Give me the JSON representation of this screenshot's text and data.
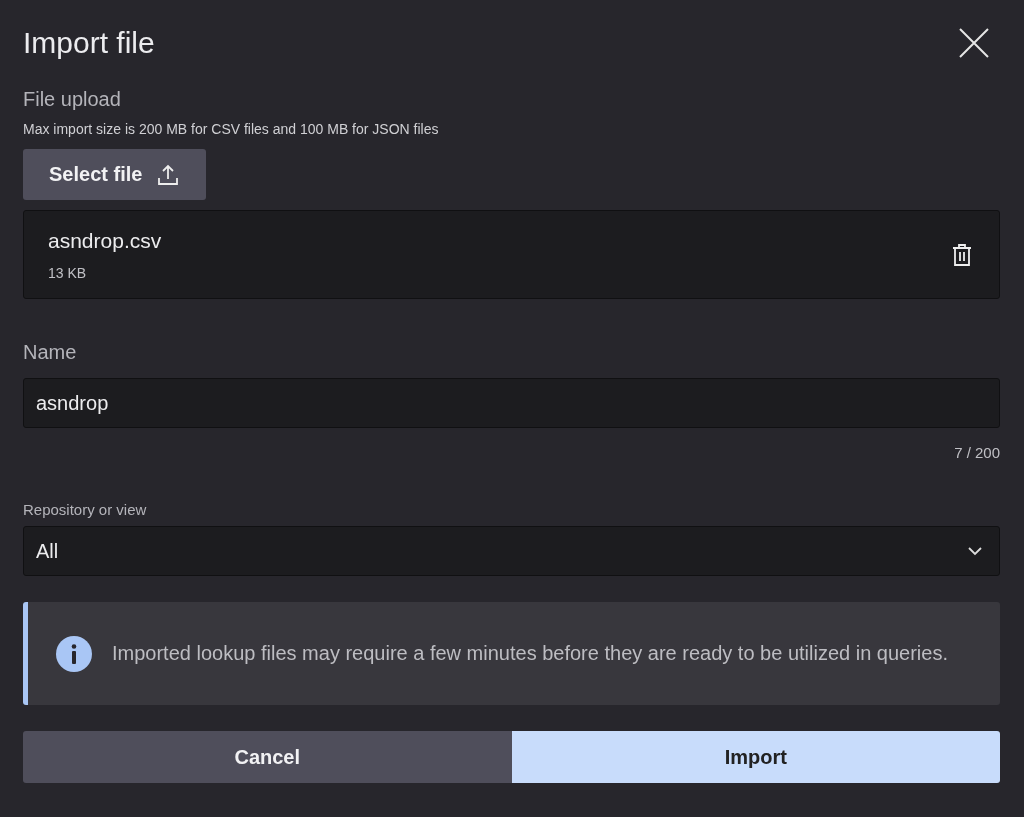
{
  "dialog": {
    "title": "Import file"
  },
  "upload": {
    "label": "File upload",
    "hint": "Max import size is 200 MB for CSV files and 100 MB for JSON files",
    "button": "Select file"
  },
  "file": {
    "name": "asndrop.csv",
    "size": "13 KB"
  },
  "name_field": {
    "label": "Name",
    "value": "asndrop",
    "counter": "7 / 200"
  },
  "repository": {
    "label": "Repository or view",
    "value": "All"
  },
  "info": {
    "text": "Imported lookup files may require a few minutes before they are ready to be utilized in queries."
  },
  "buttons": [
    {
      "label": "Cancel",
      "kind": "secondary"
    },
    {
      "label": "Import",
      "kind": "primary"
    }
  ]
}
